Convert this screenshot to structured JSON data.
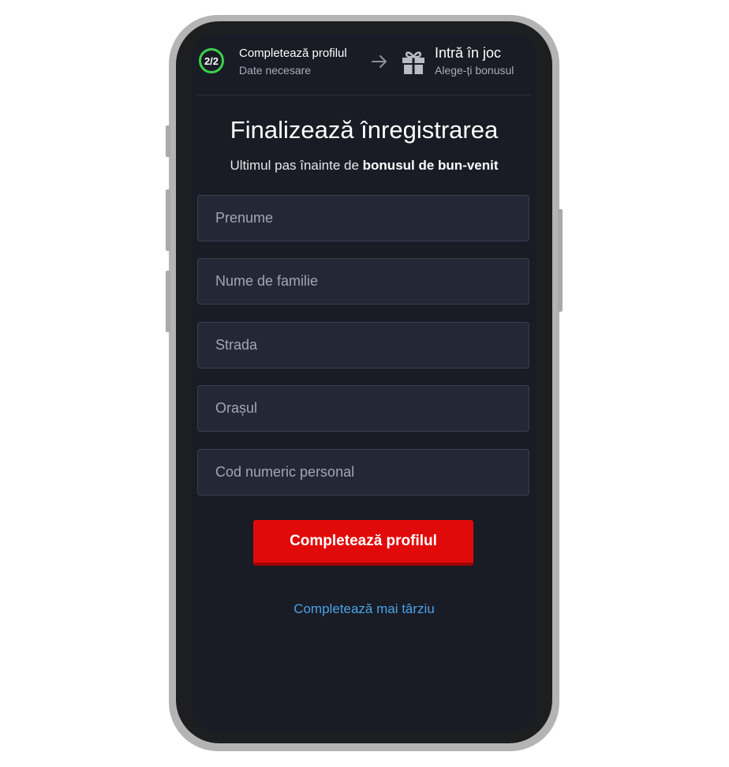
{
  "steps": {
    "badge": "2/2",
    "step1": {
      "title": "Completează profilul",
      "subtitle": "Date necesare"
    },
    "step2": {
      "title": "Intră în joc",
      "subtitle": "Alege-ți bonusul"
    },
    "accent_color": "#3bd14c",
    "icons": {
      "arrow": "arrow-right-icon",
      "gift": "gift-icon"
    }
  },
  "form": {
    "title": "Finalizează înregistrarea",
    "subtitle_prefix": "Ultimul pas înainte de ",
    "subtitle_bold": "bonusul de bun-venit",
    "fields": [
      {
        "placeholder": "Prenume",
        "value": ""
      },
      {
        "placeholder": "Nume de familie",
        "value": ""
      },
      {
        "placeholder": "Strada",
        "value": ""
      },
      {
        "placeholder": "Orașul",
        "value": ""
      },
      {
        "placeholder": "Cod numeric personal",
        "value": ""
      }
    ],
    "submit_label": "Completează profilul",
    "submit_color": "#e10a0a",
    "later_label": "Completează mai târziu",
    "link_color": "#4aa3e6"
  }
}
